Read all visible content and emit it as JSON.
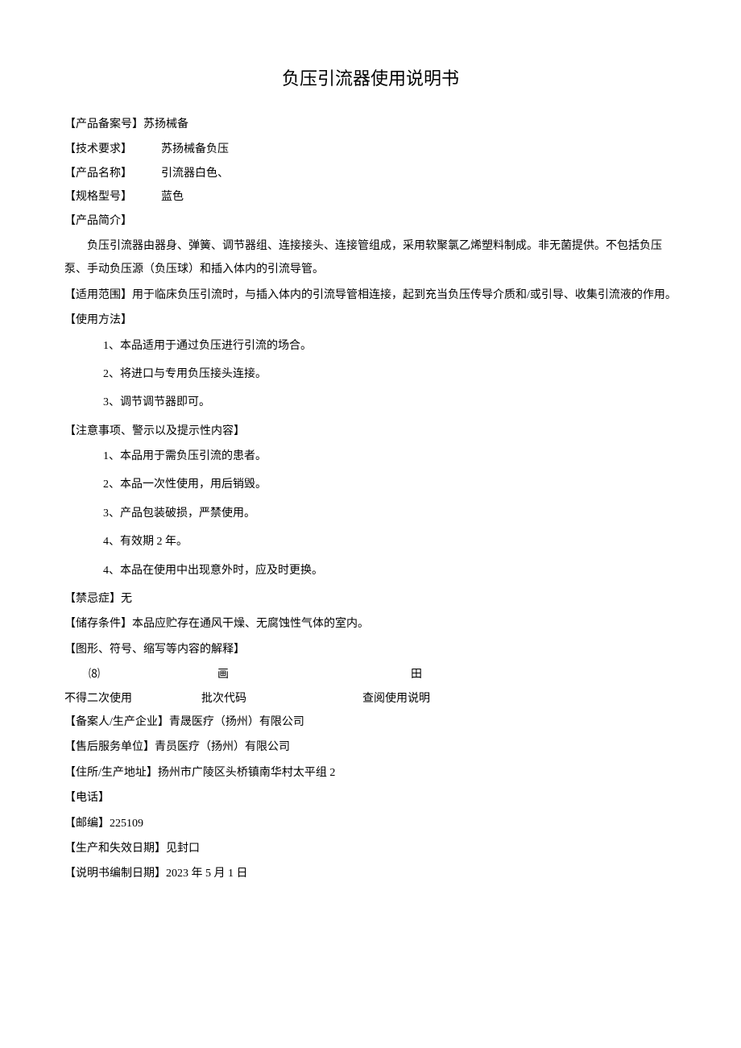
{
  "title": "负压引流器使用说明书",
  "record_number": {
    "label": "【产品备案号】",
    "value": "苏扬械备"
  },
  "tech_req": {
    "label": "【技术要求】",
    "value": "苏扬械备负压"
  },
  "product_name": {
    "label": "【产品名称】",
    "value": "引流器白色、"
  },
  "spec_model": {
    "label": "【规格型号】",
    "value": "蓝色"
  },
  "intro_label": "【产品简介】",
  "intro_body": "负压引流器由器身、弹簧、调节器组、连接接头、连接管组成，采用软聚氯乙烯塑料制成。非无菌提供。不包括负压泵、手动负压源（负压球）和插入体内的引流导管。",
  "scope": "【适用范围】用于临床负压引流时，与插入体内的引流导管相连接，起到充当负压传导介质和/或引导、收集引流液的作用。",
  "usage_label": "【使用方法】",
  "usage_items": [
    "1、本品适用于通过负压进行引流的场合。",
    "2、将进口与专用负压接头连接。",
    "3、调节调节器即可。"
  ],
  "caution_label": "【注意事项、警示以及提示性内容】",
  "caution_items": [
    "1、本品用于需负压引流的患者。",
    "2、本品一次性使用，用后销毁。",
    "3、产品包装破损，严禁使用。",
    "4、有效期 2 年。",
    "4、本品在使用中出现意外时，应及时更换。"
  ],
  "contraindication": "【禁忌症】无",
  "storage": "【储存条件】本品应贮存在通风干燥、无腐蚀性气体的室内。",
  "symbol_label": "【图形、符号、缩写等内容的解释】",
  "symbol_icons": {
    "i1": "⑻",
    "i2": "画",
    "i3": "田"
  },
  "symbol_texts": {
    "t1": "不得二次使用",
    "t2": "批次代码",
    "t3": "查阅使用说明"
  },
  "company": "【备案人/生产企业】青晟医疗（扬州）有限公司",
  "service": "【售后服务单位】青员医疗（扬州）有限公司",
  "address": "【住所/生产地址】扬州市广陵区头桥镇南华村太平组 2",
  "phone": "【电话】",
  "postcode": "【邮编】225109",
  "prod_date": "【生产和失效日期】见封口",
  "compile_date": "【说明书编制日期】2023 年 5 月 1 日"
}
